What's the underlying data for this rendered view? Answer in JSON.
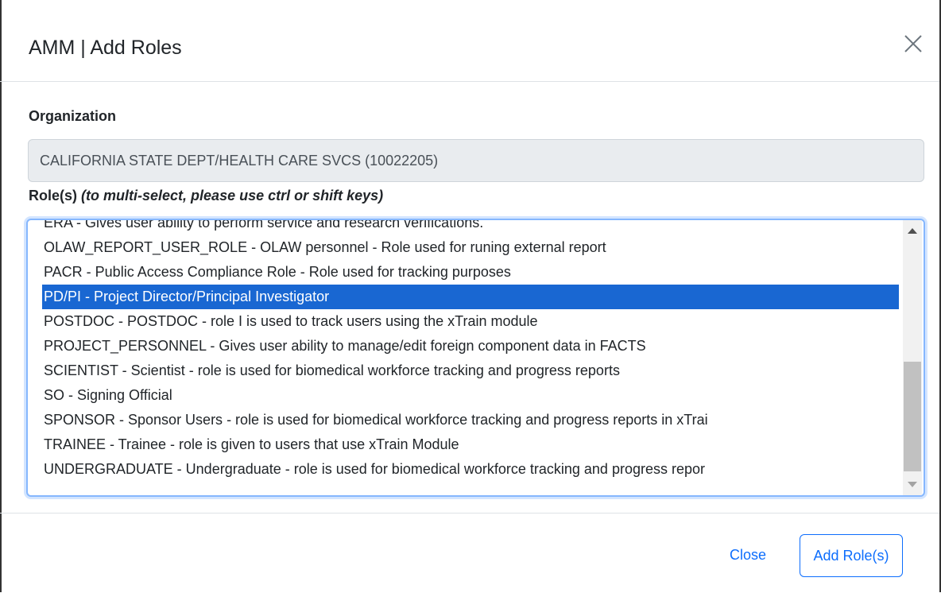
{
  "dialog": {
    "title": "AMM | Add Roles",
    "close_icon": "close-icon"
  },
  "organization": {
    "label": "Organization",
    "value": "CALIFORNIA STATE DEPT/HEALTH CARE SVCS (10022205)"
  },
  "roles": {
    "label": "Role(s)",
    "hint": "(to multi-select, please use ctrl or shift keys)",
    "items": [
      {
        "text": "ERA - Gives user ability to perform service and research verifications.",
        "selected": false
      },
      {
        "text": "OLAW_REPORT_USER_ROLE - OLAW personnel - Role used for runing external report",
        "selected": false
      },
      {
        "text": "PACR - Public Access Compliance Role - Role used for tracking purposes",
        "selected": false
      },
      {
        "text": "PD/PI - Project Director/Principal Investigator",
        "selected": true
      },
      {
        "text": "POSTDOC - POSTDOC - role I is used to track users using the xTrain module",
        "selected": false
      },
      {
        "text": "PROJECT_PERSONNEL - Gives user ability to manage/edit foreign component data in FACTS",
        "selected": false
      },
      {
        "text": "SCIENTIST - Scientist - role is used for biomedical workforce tracking and progress reports",
        "selected": false
      },
      {
        "text": "SO - Signing Official",
        "selected": false
      },
      {
        "text": "SPONSOR - Sponsor Users - role is used for biomedical workforce tracking and progress reports in xTrai",
        "selected": false
      },
      {
        "text": "TRAINEE - Trainee - role is given to users that use xTrain Module",
        "selected": false
      },
      {
        "text": "UNDERGRADUATE - Undergraduate - role is used for biomedical workforce tracking and progress repor",
        "selected": false
      }
    ]
  },
  "footer": {
    "close_label": "Close",
    "add_label": "Add Role(s)"
  },
  "colors": {
    "accent": "#0d6efd",
    "selected_bg": "#1967d2",
    "readonly_bg": "#e9ecef"
  }
}
